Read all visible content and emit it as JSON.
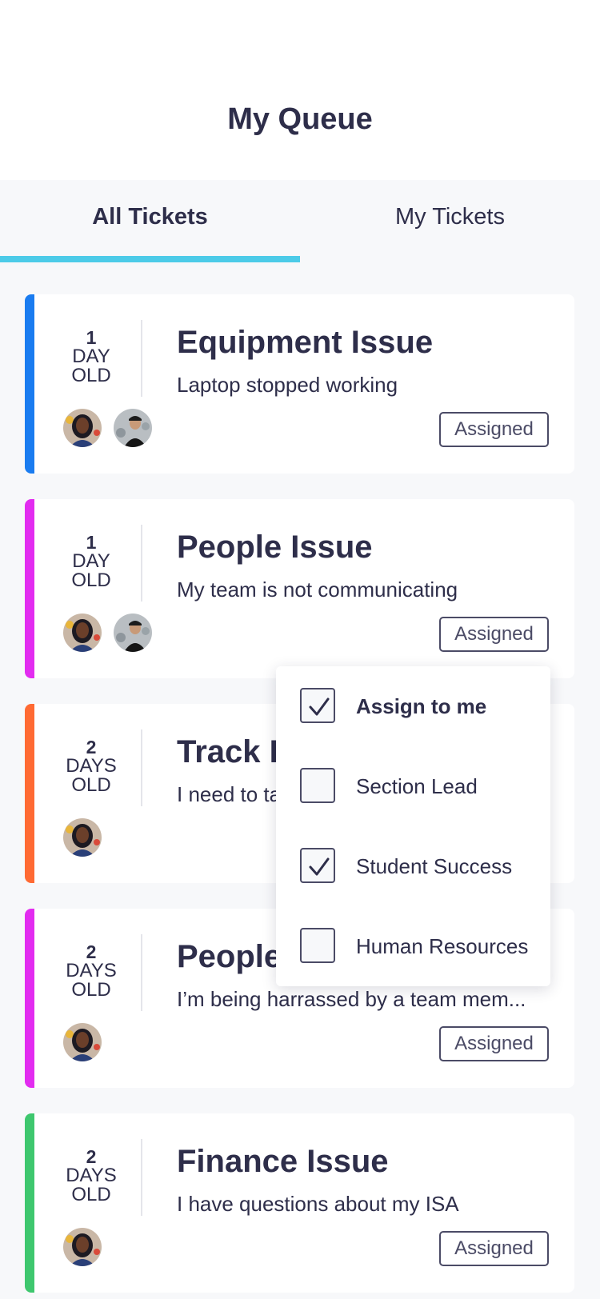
{
  "header": {
    "title": "My Queue"
  },
  "tabs": [
    {
      "label": "All Tickets",
      "active": true
    },
    {
      "label": "My Tickets",
      "active": false
    }
  ],
  "colors": {
    "accent": "#4ccbe8",
    "equipment": "#1a7cf0",
    "people": "#e22cf0",
    "track": "#ff6a33",
    "finance": "#3ec76e"
  },
  "tickets": [
    {
      "age_num": "1",
      "age_unit": "DAY",
      "age_old": "OLD",
      "title": "Equipment Issue",
      "description": "Laptop stopped working",
      "status": "Assigned",
      "color": "#1a7cf0",
      "avatars": [
        "woman-avatar",
        "man-avatar"
      ]
    },
    {
      "age_num": "1",
      "age_unit": "DAY",
      "age_old": "OLD",
      "title": "People Issue",
      "description": "My team is not communicating",
      "status": "Assigned",
      "color": "#e22cf0",
      "avatars": [
        "woman-avatar",
        "man-avatar"
      ]
    },
    {
      "age_num": "2",
      "age_unit": "DAYS",
      "age_old": "OLD",
      "title": "Track Is",
      "description": "I need to ta",
      "status": "",
      "color": "#ff6a33",
      "avatars": [
        "woman-avatar"
      ]
    },
    {
      "age_num": "2",
      "age_unit": "DAYS",
      "age_old": "OLD",
      "title": "People",
      "description": "I’m being harrassed by a team mem...",
      "status": "Assigned",
      "color": "#e22cf0",
      "avatars": [
        "woman-avatar"
      ]
    },
    {
      "age_num": "2",
      "age_unit": "DAYS",
      "age_old": "OLD",
      "title": "Finance Issue",
      "description": "I have questions about my ISA",
      "status": "Assigned",
      "color": "#3ec76e",
      "avatars": [
        "woman-avatar"
      ]
    }
  ],
  "dropdown": {
    "items": [
      {
        "label": "Assign to me",
        "checked": true,
        "bold": true
      },
      {
        "label": "Section Lead",
        "checked": false,
        "bold": false
      },
      {
        "label": "Student Success",
        "checked": true,
        "bold": false
      },
      {
        "label": "Human Resources",
        "checked": false,
        "bold": false
      }
    ]
  }
}
